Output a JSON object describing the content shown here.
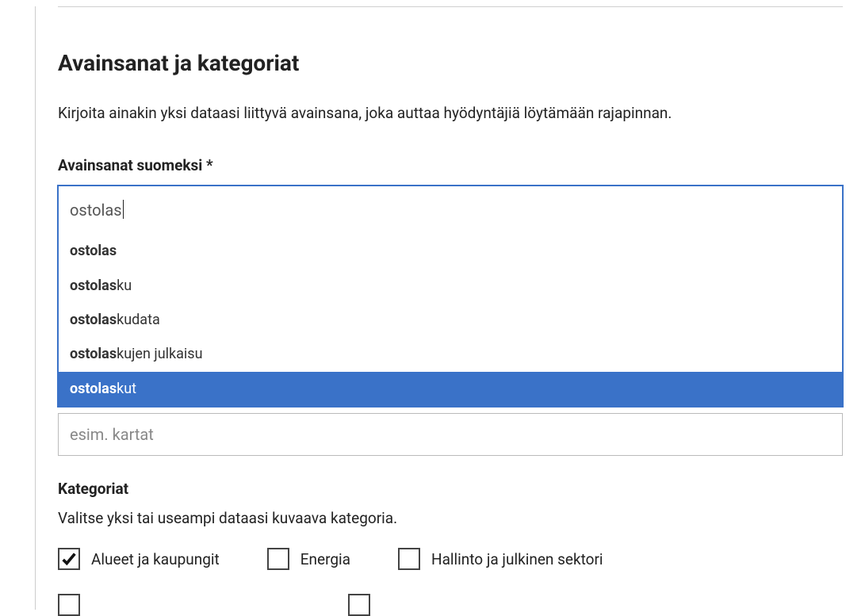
{
  "section": {
    "title": "Avainsanat ja kategoriat",
    "description": "Kirjoita ainakin yksi dataasi liittyvä avainsana, joka auttaa hyödyntäjiä löytämään rajapinnan."
  },
  "keywordsField": {
    "label": "Avainsanat suomeksi *",
    "inputValue": "ostolas",
    "suggestions": [
      {
        "match": "ostolas",
        "rest": ""
      },
      {
        "match": "ostolas",
        "rest": "ku"
      },
      {
        "match": "ostolas",
        "rest": "kudata"
      },
      {
        "match": "ostolas",
        "rest": "kujen julkaisu"
      },
      {
        "match": "ostolas",
        "rest": "kut"
      }
    ],
    "highlightedIndex": 4,
    "secondPlaceholder": "esim. kartat"
  },
  "categories": {
    "label": "Kategoriat",
    "description": "Valitse yksi tai useampi dataasi kuvaava kategoria.",
    "options": [
      {
        "label": "Alueet ja kaupungit",
        "checked": true
      },
      {
        "label": "Energia",
        "checked": false
      },
      {
        "label": "Hallinto ja julkinen sektori",
        "checked": false
      }
    ]
  }
}
